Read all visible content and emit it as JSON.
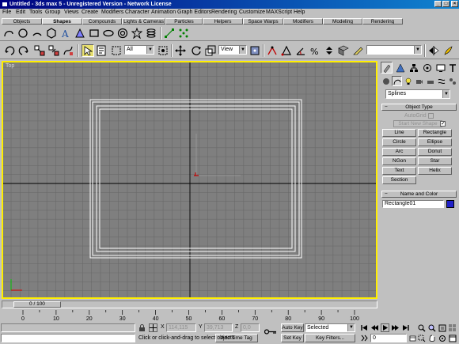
{
  "window": {
    "title": "Untitled - 3ds max 5 - Unregistered Version - Network License",
    "minimize_label": "_",
    "maximize_label": "□",
    "close_label": "×"
  },
  "menu": [
    "File",
    "Edit",
    "Tools",
    "Group",
    "Views",
    "Create",
    "Modifiers",
    "Character",
    "Animation",
    "Graph Editors",
    "Rendering",
    "Customize",
    "MAXScript",
    "Help"
  ],
  "tabs": [
    "Objects",
    "Shapes",
    "Compounds",
    "Lights & Cameras",
    "Particles",
    "Helpers",
    "Space Warps",
    "Modifiers",
    "Modeling",
    "Rendering"
  ],
  "active_tab": "Shapes",
  "toolbar": {
    "selection_filter": "All",
    "reference_coord": "View",
    "named_selection": ""
  },
  "viewport": {
    "label": "Top",
    "grid_color": "#6a6a6a",
    "axis_color": "#000000",
    "background": "#7f7f7f",
    "border_color": "#ffee00"
  },
  "command_panel": {
    "category": "Splines",
    "object_type_header": "Object Type",
    "autogrid_label": "AutoGrid",
    "start_new_shape_label": "Start New Shape",
    "buttons": [
      "Line",
      "Rectangle",
      "Circle",
      "Ellipse",
      "Arc",
      "Donut",
      "NGon",
      "Star",
      "Text",
      "Helix",
      "Section"
    ],
    "name_color_header": "Name and Color",
    "object_name": "Rectangle01",
    "object_color": "#2020c8"
  },
  "timeline": {
    "frame_label": "0 / 100",
    "ticks": [
      "0",
      "10",
      "20",
      "30",
      "40",
      "50",
      "60",
      "70",
      "80",
      "90",
      "100"
    ]
  },
  "status": {
    "x_label": "X",
    "x_value": "114,115",
    "y_label": "Y",
    "y_value": "39,713",
    "z_label": "Z",
    "z_value": "0,0",
    "prompt": "Click or click-and-drag to select objects",
    "add_time_tag": "Add Time Tag",
    "auto_key": "Auto Key",
    "set_key": "Set Key",
    "key_mode": "Selected",
    "key_filters": "Key Filters...",
    "current_frame": "0"
  }
}
